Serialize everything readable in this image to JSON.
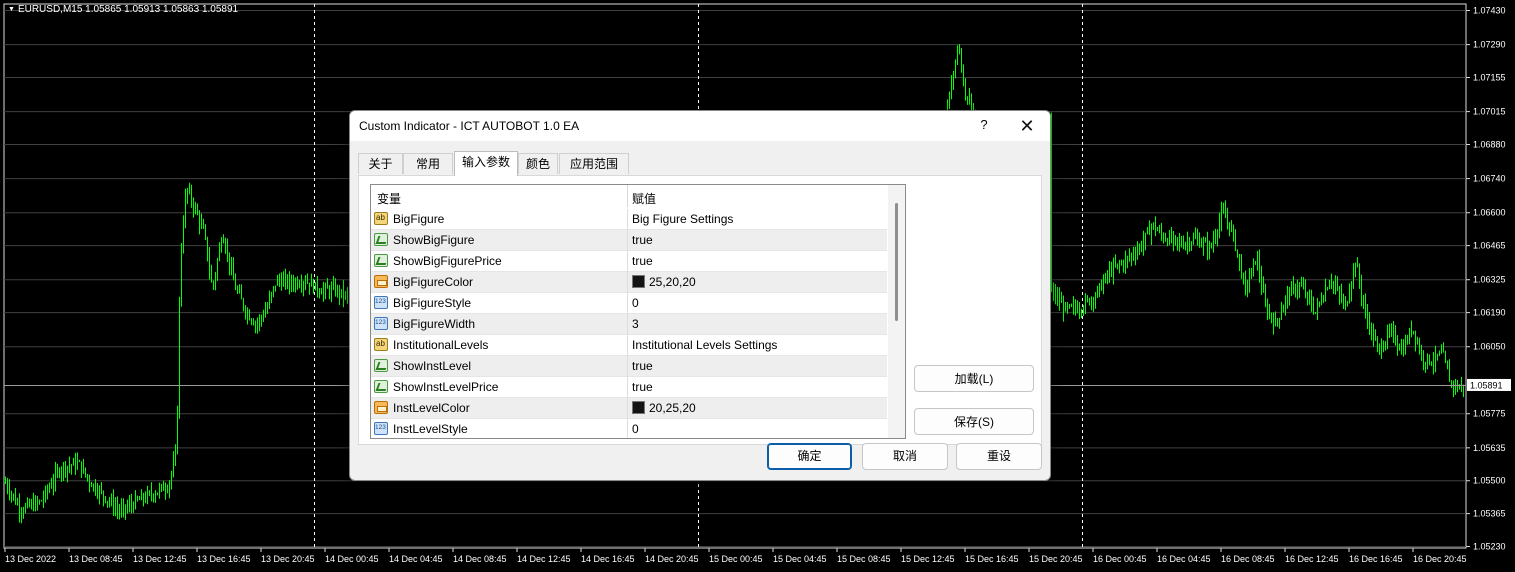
{
  "chart": {
    "header": "EURUSD,M15  1.05865 1.05913 1.05863 1.05891",
    "price_labels": [
      "1.07430",
      "1.07290",
      "1.07155",
      "1.07015",
      "1.06880",
      "1.06740",
      "1.06600",
      "1.06465",
      "1.06325",
      "1.06190",
      "1.06050",
      "1.05775",
      "1.05635",
      "1.05500",
      "1.05365",
      "1.05230"
    ],
    "current_price": "1.05891",
    "time_labels": [
      "13 Dec 2022",
      "13 Dec 08:45",
      "13 Dec 12:45",
      "13 Dec 16:45",
      "13 Dec 20:45",
      "14 Dec 00:45",
      "14 Dec 04:45",
      "14 Dec 08:45",
      "14 Dec 12:45",
      "14 Dec 16:45",
      "14 Dec 20:45",
      "15 Dec 00:45",
      "15 Dec 04:45",
      "15 Dec 08:45",
      "15 Dec 12:45",
      "15 Dec 16:45",
      "15 Dec 20:45",
      "16 Dec 00:45",
      "16 Dec 04:45",
      "16 Dec 08:45",
      "16 Dec 12:45",
      "16 Dec 16:45",
      "16 Dec 20:45"
    ],
    "colors": {
      "background": "#000000",
      "candle": "#00ff00",
      "grid": "#ffffff",
      "axis_text": "#ffffff"
    }
  },
  "dialog": {
    "title": "Custom Indicator - ICT AUTOBOT 1.0 EA",
    "help": "?",
    "close": "✕",
    "tabs": [
      "关于",
      "常用",
      "输入参数",
      "颜色",
      "应用范围"
    ],
    "active_tab": "输入参数",
    "columns": [
      "变量",
      "赋值"
    ],
    "rows": [
      {
        "icon": "ab",
        "name": "BigFigure",
        "value": "Big Figure Settings"
      },
      {
        "icon": "bool",
        "name": "ShowBigFigure",
        "value": "true"
      },
      {
        "icon": "bool",
        "name": "ShowBigFigurePrice",
        "value": "true"
      },
      {
        "icon": "color",
        "name": "BigFigureColor",
        "value": "25,20,20"
      },
      {
        "icon": "num",
        "name": "BigFigureStyle",
        "value": "0"
      },
      {
        "icon": "num",
        "name": "BigFigureWidth",
        "value": "3"
      },
      {
        "icon": "ab",
        "name": "InstitutionalLevels",
        "value": "Institutional Levels Settings"
      },
      {
        "icon": "bool",
        "name": "ShowInstLevel",
        "value": "true"
      },
      {
        "icon": "bool",
        "name": "ShowInstLevelPrice",
        "value": "true"
      },
      {
        "icon": "color",
        "name": "InstLevelColor",
        "value": "20,25,20"
      },
      {
        "icon": "num",
        "name": "InstLevelStyle",
        "value": "0"
      }
    ],
    "load_button": "加载(L)",
    "save_button": "保存(S)",
    "ok_button": "确定",
    "cancel_button": "取消",
    "reset_button": "重设"
  }
}
